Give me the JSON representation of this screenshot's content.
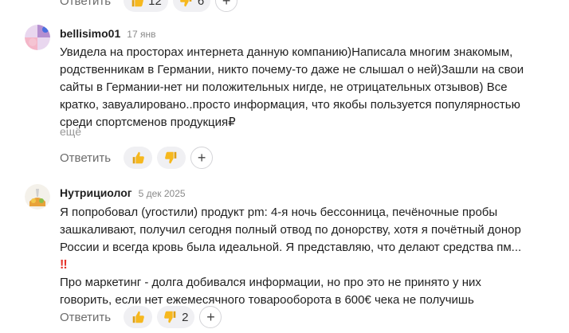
{
  "previous_comment": {
    "reply_label": "Ответить",
    "like_count": "12",
    "dislike_count": "6",
    "add_reaction": "+"
  },
  "comments": [
    {
      "author": "bellisimo01",
      "date": "17 янв",
      "lines": [
        "Увидела на просторах интернета данную компанию)Написала многим знакомым,",
        "родственникам в Германии, никто почему-то даже не слышал о ней)Зашли на свои",
        "сайты в Германии-нет ни положительных нигде, не отрицательных отзывов) Все",
        "кратко, завуалировано..просто информация, что якобы пользуется популярностью",
        "среди спортсменов продукция₽"
      ],
      "more_label": "ещё",
      "reply_label": "Ответить",
      "add_reaction": "+"
    },
    {
      "author": "Нутрициолог",
      "date": "5 дек 2025",
      "lines": [
        "Я попробовал (угостили) продукт pm: 4-я ночь бессонница, печёночные пробы",
        "зашкаливают, получил сегодня полный отвод по донорству, хотя я почётный донор",
        "России и всегда кровь была идеальной. Я представляю, что делают средства пм...",
        "‼",
        "Про маркетинг - долга добивался информации, но про это не принято у них",
        "говорить, если нет ежемесячного товарооборота в 600€ чека не получишь"
      ],
      "reply_label": "Ответить",
      "dislike_count": "2",
      "add_reaction": "+"
    }
  ],
  "icons": {
    "like": "thumbs-up-icon",
    "dislike": "thumbs-down-icon",
    "add": "plus-icon"
  },
  "colors": {
    "reaction_bg": "#f0f0f3",
    "muted_text": "#8a8a8a",
    "emoji_yellow": "#f6b81e",
    "exclamation_red": "#e5332a"
  }
}
